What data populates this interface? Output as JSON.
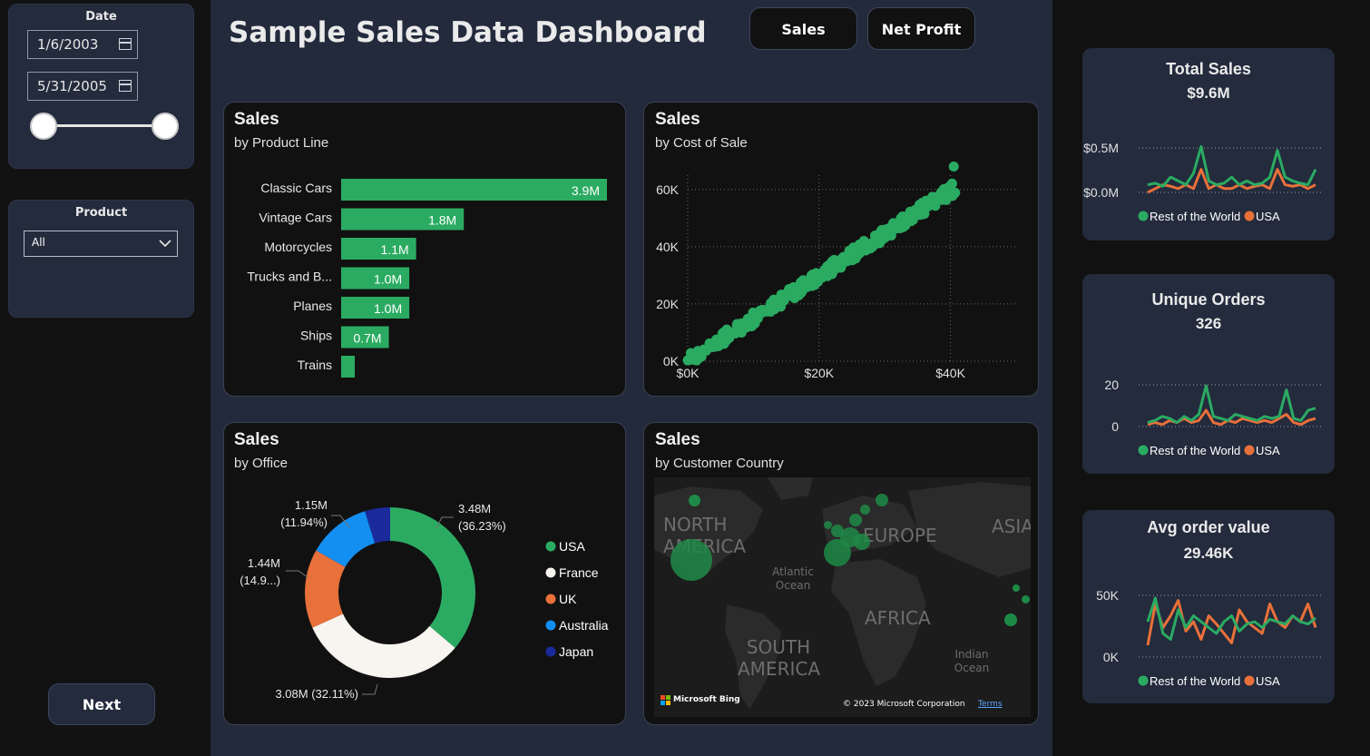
{
  "title": "Sample Sales Data Dashboard",
  "toggles": {
    "sales": "Sales",
    "net_profit": "Net Profit"
  },
  "date_slicer": {
    "title": "Date",
    "start": "1/6/2003",
    "end": "5/31/2005"
  },
  "product_slicer": {
    "title": "Product",
    "value": "All"
  },
  "next_button": "Next",
  "colors": {
    "green": "#2bab62",
    "orange": "#e8703a",
    "white": "#f8f4f0",
    "blue": "#138ef1",
    "navy": "#1a2a9a"
  },
  "cards": {
    "product_line": {
      "title": "Sales",
      "subtitle": "by Product Line"
    },
    "cost_of_sale": {
      "title": "Sales",
      "subtitle": "by Cost of Sale"
    },
    "office": {
      "title": "Sales",
      "subtitle": "by Office"
    },
    "country": {
      "title": "Sales",
      "subtitle": "by Customer Country"
    }
  },
  "map": {
    "labels": [
      "NORTH AMERICA",
      "EUROPE",
      "ASIA",
      "Atlantic Ocean",
      "AFRICA",
      "SOUTH AMERICA",
      "Indian Ocean"
    ],
    "brand": "Microsoft Bing",
    "copyright": "© 2023 Microsoft Corporation",
    "terms": "Terms"
  },
  "kpis": {
    "total_sales": {
      "title": "Total Sales",
      "value": "$9.6M",
      "ticks": [
        "$0.5M",
        "$0.0M"
      ]
    },
    "unique_orders": {
      "title": "Unique Orders",
      "value": "326",
      "ticks": [
        "20",
        "0"
      ]
    },
    "avg_order": {
      "title": "Avg order value",
      "value": "29.46K",
      "ticks": [
        "50K",
        "0K"
      ]
    },
    "legend": [
      "Rest of the World",
      "USA"
    ]
  },
  "chart_data": [
    {
      "type": "bar",
      "orientation": "horizontal",
      "categories": [
        "Classic Cars",
        "Vintage Cars",
        "Motorcycles",
        "Trucks and B...",
        "Planes",
        "Ships",
        "Trains"
      ],
      "values": [
        3.9,
        1.8,
        1.1,
        1.0,
        1.0,
        0.7,
        0.2
      ],
      "value_labels": [
        "3.9M",
        "1.8M",
        "1.1M",
        "1.0M",
        "1.0M",
        "0.7M",
        ""
      ],
      "title": "Sales",
      "subtitle": "by Product Line"
    },
    {
      "type": "scatter",
      "title": "Sales",
      "subtitle": "by Cost of Sale",
      "x_ticks": [
        "$0K",
        "$20K",
        "$40K"
      ],
      "y_ticks": [
        "0K",
        "20K",
        "40K",
        "60K"
      ],
      "xlim": [
        0,
        50000
      ],
      "ylim": [
        0,
        65000
      ],
      "trend": {
        "x_start": 0,
        "y_start": 0,
        "x_end": 41000,
        "y_end": 61000,
        "n_points": 300
      },
      "outlier": {
        "x": 40500,
        "y": 68000
      }
    },
    {
      "type": "pie",
      "donut": true,
      "title": "Sales",
      "subtitle": "by Office",
      "slices": [
        {
          "name": "USA",
          "value": 3.48,
          "label": "3.48M",
          "pct": "(36.23%)"
        },
        {
          "name": "France",
          "value": 3.08,
          "label": "3.08M (32.11%)",
          "pct": ""
        },
        {
          "name": "UK",
          "value": 1.44,
          "label": "1.44M",
          "pct": "(14.9...)"
        },
        {
          "name": "Australia",
          "value": 1.15,
          "label": "1.15M",
          "pct": "(11.94%)"
        },
        {
          "name": "Japan",
          "value": 0.46,
          "label": "",
          "pct": ""
        }
      ],
      "legend": [
        "USA",
        "France",
        "UK",
        "Australia",
        "Japan"
      ]
    },
    {
      "type": "line",
      "title": "Total Sales",
      "series": [
        {
          "name": "Rest of the World",
          "values": [
            0.1,
            0.12,
            0.08,
            0.2,
            0.15,
            0.1,
            0.25,
            0.6,
            0.15,
            0.1,
            0.12,
            0.2,
            0.1,
            0.15,
            0.1,
            0.12,
            0.2,
            0.55,
            0.2,
            0.15,
            0.12,
            0.1,
            0.3
          ]
        },
        {
          "name": "USA",
          "values": [
            0.0,
            0.05,
            0.1,
            0.08,
            0.05,
            0.1,
            0.05,
            0.3,
            0.05,
            0.1,
            0.05,
            0.05,
            0.1,
            0.05,
            0.08,
            0.1,
            0.05,
            0.3,
            0.1,
            0.08,
            0.1,
            0.05,
            0.1
          ]
        }
      ],
      "ylim": [
        0,
        0.7
      ]
    },
    {
      "type": "line",
      "title": "Unique Orders",
      "series": [
        {
          "name": "Rest of the World",
          "values": [
            2,
            3,
            5,
            4,
            2,
            5,
            3,
            6,
            20,
            5,
            4,
            3,
            6,
            5,
            4,
            3,
            5,
            4,
            5,
            18,
            4,
            3,
            8,
            9
          ]
        },
        {
          "name": "USA",
          "values": [
            1,
            2,
            1,
            3,
            2,
            4,
            2,
            3,
            8,
            2,
            1,
            3,
            2,
            4,
            3,
            2,
            3,
            2,
            4,
            6,
            2,
            1,
            3,
            4
          ]
        }
      ],
      "ylim": [
        0,
        25
      ]
    },
    {
      "type": "line",
      "title": "Avg order value",
      "series": [
        {
          "name": "Rest of the World",
          "values": [
            30,
            50,
            20,
            15,
            40,
            25,
            35,
            30,
            25,
            20,
            30,
            35,
            22,
            28,
            30,
            25,
            32,
            30,
            28,
            35,
            30,
            28,
            33
          ]
        },
        {
          "name": "USA",
          "values": [
            10,
            45,
            25,
            35,
            48,
            22,
            30,
            15,
            35,
            28,
            20,
            12,
            40,
            30,
            25,
            20,
            45,
            30,
            25,
            35,
            30,
            45,
            25
          ]
        }
      ],
      "ylim": [
        0,
        60
      ]
    }
  ]
}
